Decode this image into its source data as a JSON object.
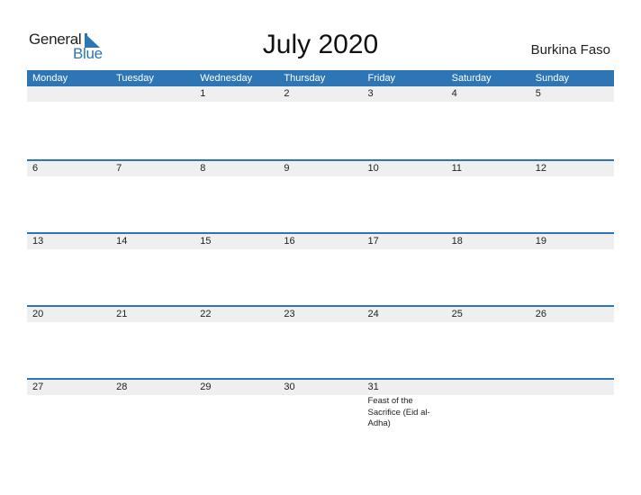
{
  "logo": {
    "text_general": "General",
    "text_blue": "Blue",
    "icon": "triangle-flag-icon"
  },
  "title": "July 2020",
  "country": "Burkina Faso",
  "colors": {
    "accent": "#2e75b6",
    "date_strip": "#efefef",
    "text": "#222222"
  },
  "weekdays": [
    "Monday",
    "Tuesday",
    "Wednesday",
    "Thursday",
    "Friday",
    "Saturday",
    "Sunday"
  ],
  "weeks": [
    {
      "days": [
        "",
        "",
        "1",
        "2",
        "3",
        "4",
        "5"
      ],
      "events": [
        "",
        "",
        "",
        "",
        "",
        "",
        ""
      ]
    },
    {
      "days": [
        "6",
        "7",
        "8",
        "9",
        "10",
        "11",
        "12"
      ],
      "events": [
        "",
        "",
        "",
        "",
        "",
        "",
        ""
      ]
    },
    {
      "days": [
        "13",
        "14",
        "15",
        "16",
        "17",
        "18",
        "19"
      ],
      "events": [
        "",
        "",
        "",
        "",
        "",
        "",
        ""
      ]
    },
    {
      "days": [
        "20",
        "21",
        "22",
        "23",
        "24",
        "25",
        "26"
      ],
      "events": [
        "",
        "",
        "",
        "",
        "",
        "",
        ""
      ]
    },
    {
      "days": [
        "27",
        "28",
        "29",
        "30",
        "31",
        "",
        ""
      ],
      "events": [
        "",
        "",
        "",
        "",
        "Feast of the Sacrifice (Eid al-Adha)",
        "",
        ""
      ]
    }
  ]
}
